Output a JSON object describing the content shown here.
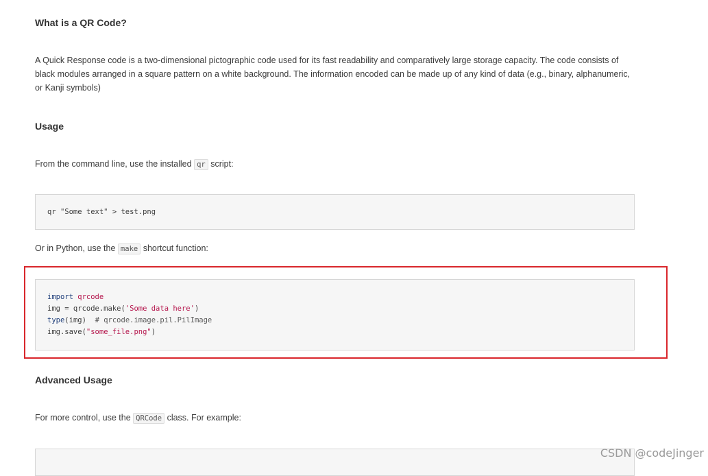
{
  "sections": {
    "what": {
      "heading": "What is a QR Code?",
      "paragraph_line1": "A Quick Response code is a two-dimensional pictographic code used for its fast readability and comparatively large storage capacity. The code consists of",
      "paragraph_line2": "black modules arranged in a square pattern on a white background. The information encoded can be made up of any kind of data (e.g., binary, alphanumeric,",
      "paragraph_line3": "or Kanji symbols)"
    },
    "usage": {
      "heading": "Usage",
      "cli_intro_before": "From the command line, use the installed",
      "cli_intro_code": "qr",
      "cli_intro_after": "script:",
      "cli_code": "qr \"Some text\" > test.png",
      "python_intro_before": "Or in Python, use the",
      "python_intro_code": "make",
      "python_intro_after": "shortcut function:",
      "python_code": {
        "l1_kw": "import",
        "l1_mod": "qrcode",
        "l2_pre": "img = qrcode.make(",
        "l2_str": "'Some data here'",
        "l2_post": ")",
        "l3_kw": "type",
        "l3_post": "(img)",
        "l3_comment": "# qrcode.image.pil.PilImage",
        "l4_pre": "img.save(",
        "l4_str": "\"some_file.png\"",
        "l4_post": ")"
      }
    },
    "advanced": {
      "heading": "Advanced Usage",
      "intro_before": "For more control, use the",
      "intro_code": "QRCode",
      "intro_after": "class. For example:"
    }
  },
  "watermark": "CSDN @codeJinger",
  "colors": {
    "highlight_border": "#d9262b",
    "keyword": "#1f3e7a",
    "string": "#b5174d"
  }
}
